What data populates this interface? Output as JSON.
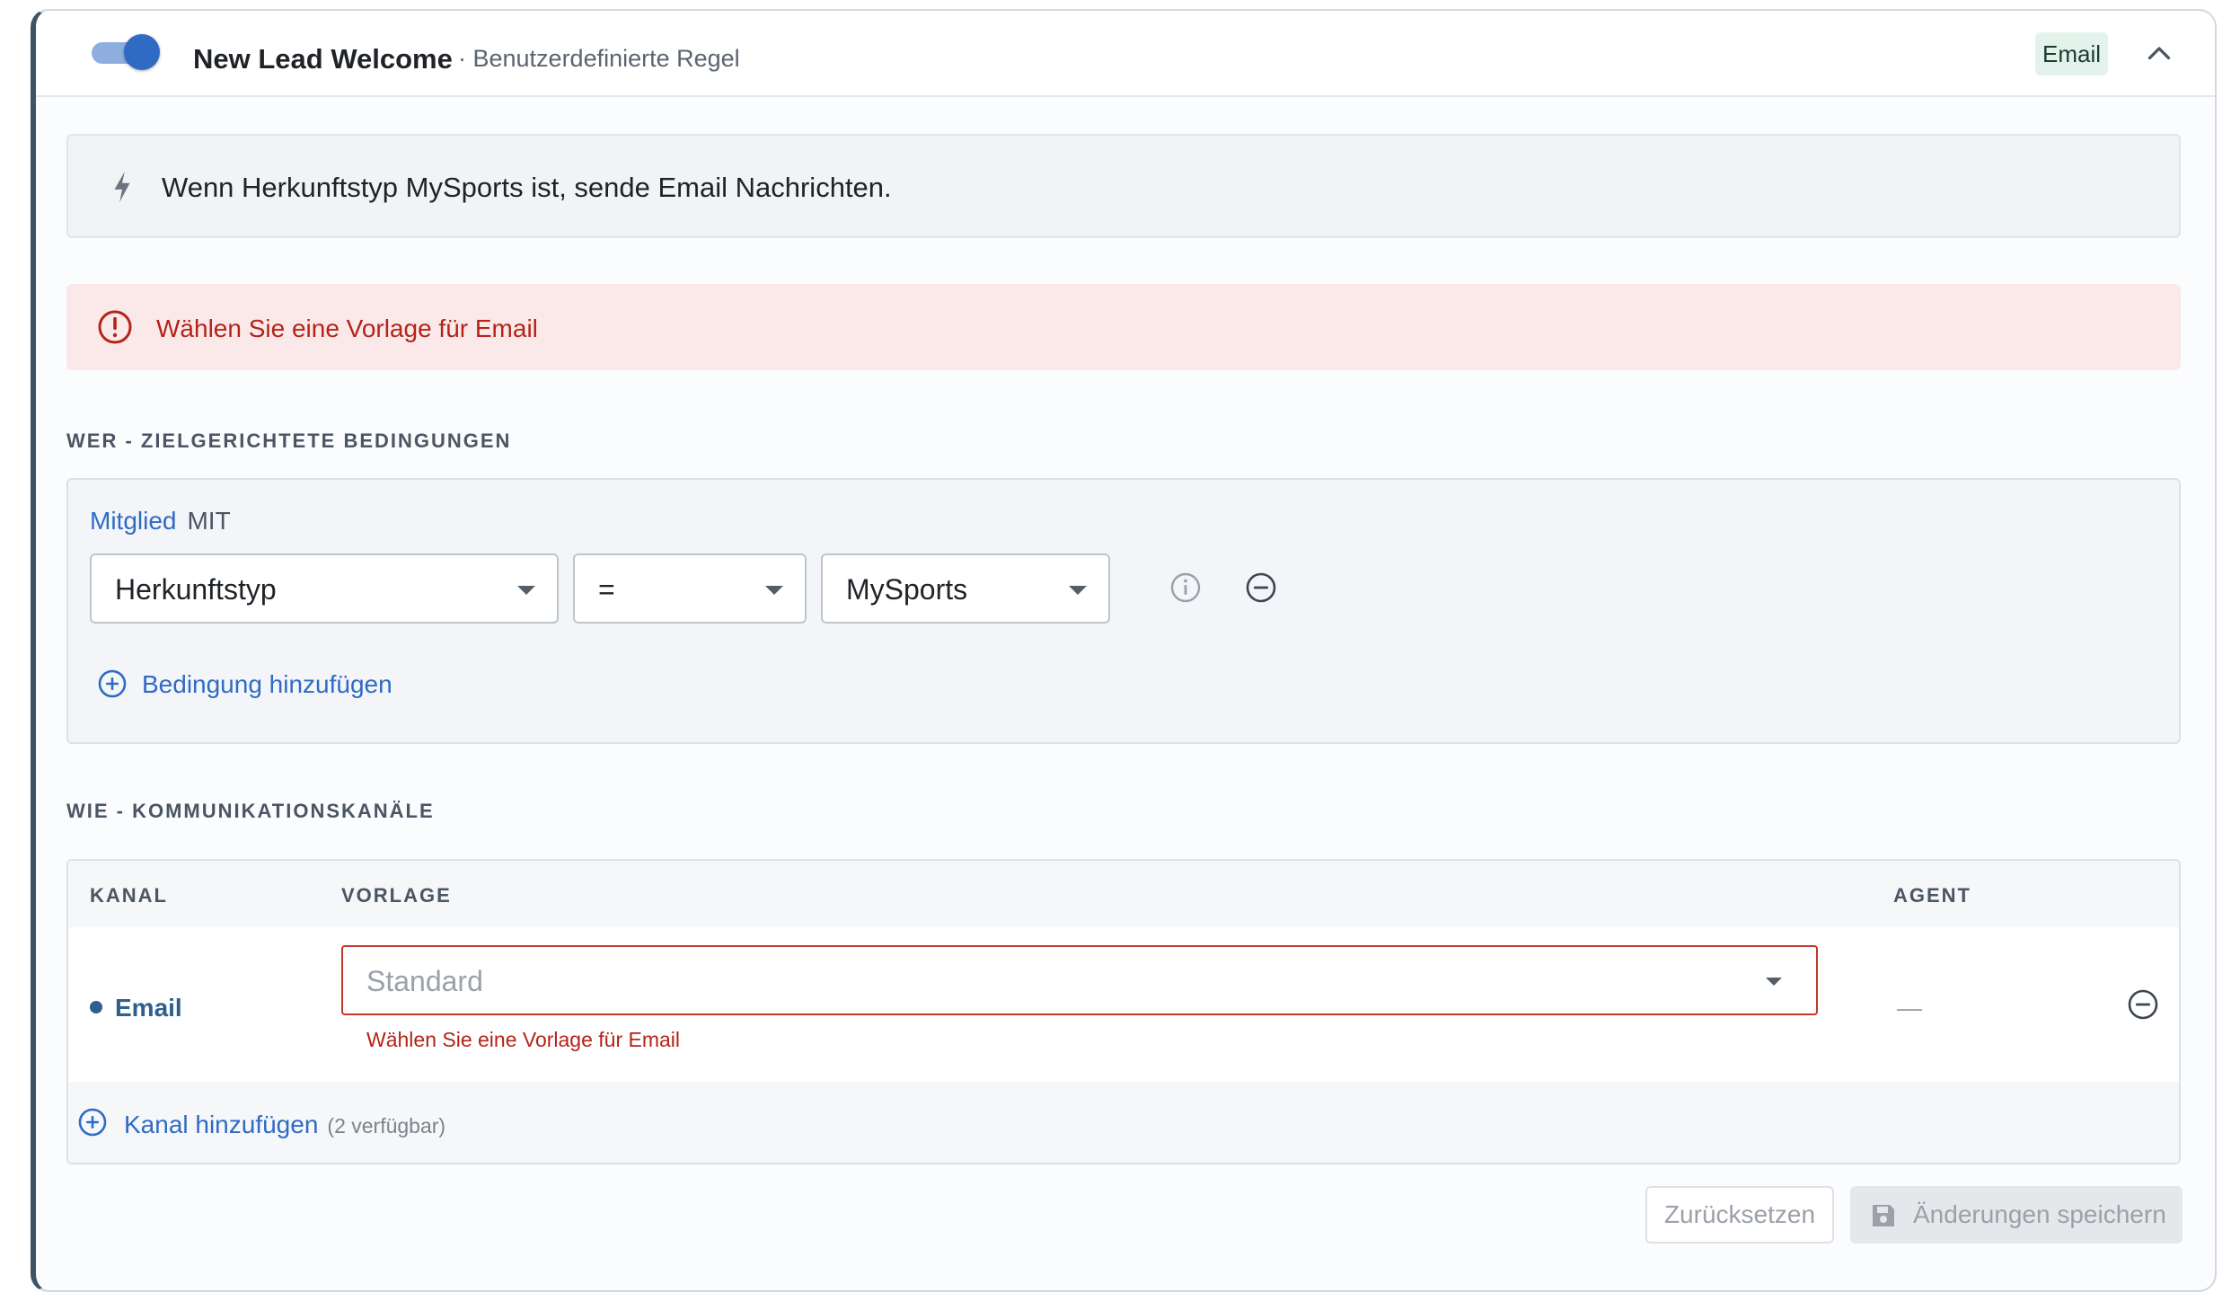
{
  "rule": {
    "title": "New Lead Welcome",
    "subtitle": "· Benutzerdefinierte Regel",
    "enabled": true,
    "channel_badge": "Email"
  },
  "summary": {
    "text": "Wenn Herkunftstyp MySports ist, sende Email Nachrichten."
  },
  "alert": {
    "text": "Wählen Sie eine Vorlage für Email"
  },
  "who": {
    "section_title": "WER - ZIELGERICHTETE BEDINGUNGEN",
    "entity_label": "Mitglied",
    "joiner": "MIT",
    "condition": {
      "field": "Herkunftstyp",
      "operator": "=",
      "value": "MySports"
    },
    "add_condition_label": "Bedingung hinzufügen"
  },
  "how": {
    "section_title": "WIE - KOMMUNIKATIONSKANÄLE",
    "columns": [
      "KANAL",
      "VORLAGE",
      "AGENT"
    ],
    "rows": [
      {
        "channel": "Email",
        "template_placeholder": "Standard",
        "template_error": "Wählen Sie eine Vorlage für Email",
        "agent": "—"
      }
    ],
    "add_channel_label": "Kanal hinzufügen",
    "available_note": "(2 verfügbar)"
  },
  "actions": {
    "reset_label": "Zurücksetzen",
    "save_label": "Änderungen speichern"
  },
  "colors": {
    "accent": "#2f6bc4",
    "error": "#b42318",
    "badge_bg": "#e4f2ec"
  },
  "icons": [
    "bolt-icon",
    "alert-circle-icon",
    "chevron-up-icon",
    "info-icon",
    "minus-circle-icon",
    "plus-circle-icon",
    "save-icon"
  ]
}
